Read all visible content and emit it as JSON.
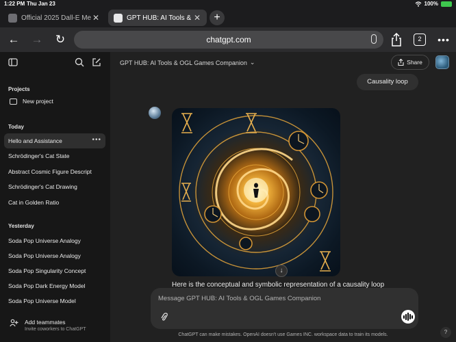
{
  "status_bar": {
    "time": "1:22 PM",
    "date": "Thu Jan 23",
    "battery": "100%"
  },
  "browser": {
    "tabs": [
      {
        "title": "Official 2025 Dall-E Me",
        "active": false
      },
      {
        "title": "GPT HUB: AI Tools & OG",
        "active": true
      }
    ],
    "url": "chatgpt.com",
    "tab_count": "2"
  },
  "sidebar": {
    "projects_label": "Projects",
    "new_project": "New project",
    "today_label": "Today",
    "today_items": [
      "Hello and Assistance",
      "Schrödinger's Cat State",
      "Abstract Cosmic Figure Descript",
      "Schrödinger's Cat Drawing",
      "Cat in Golden Ratio"
    ],
    "yesterday_label": "Yesterday",
    "yesterday_items": [
      "Soda Pop Universe Analogy",
      "Soda Pop Universe Analogy",
      "Soda Pop Singularity Concept",
      "Soda Pop Dark Energy Model",
      "Soda Pop Universe Model"
    ],
    "add_teammates": "Add teammates",
    "add_teammates_sub": "Invite coworkers to ChatGPT"
  },
  "main": {
    "chat_title": "GPT HUB: AI Tools & OGL Games Companion",
    "share_label": "Share",
    "user_message": "Causality loop",
    "response_text": "Here is the conceptual and symbolic representation of a causality loop",
    "composer_placeholder": "Message GPT HUB: AI Tools & OGL Games Companion",
    "disclaimer": "ChatGPT can make mistakes. OpenAI doesn't use Games INC. workspace data to train its models.",
    "help_label": "?"
  },
  "colors": {
    "sidebar_bg": "#171717",
    "main_bg": "#212121",
    "bubble_bg": "#303030",
    "art_gold": "#e6a63a"
  }
}
